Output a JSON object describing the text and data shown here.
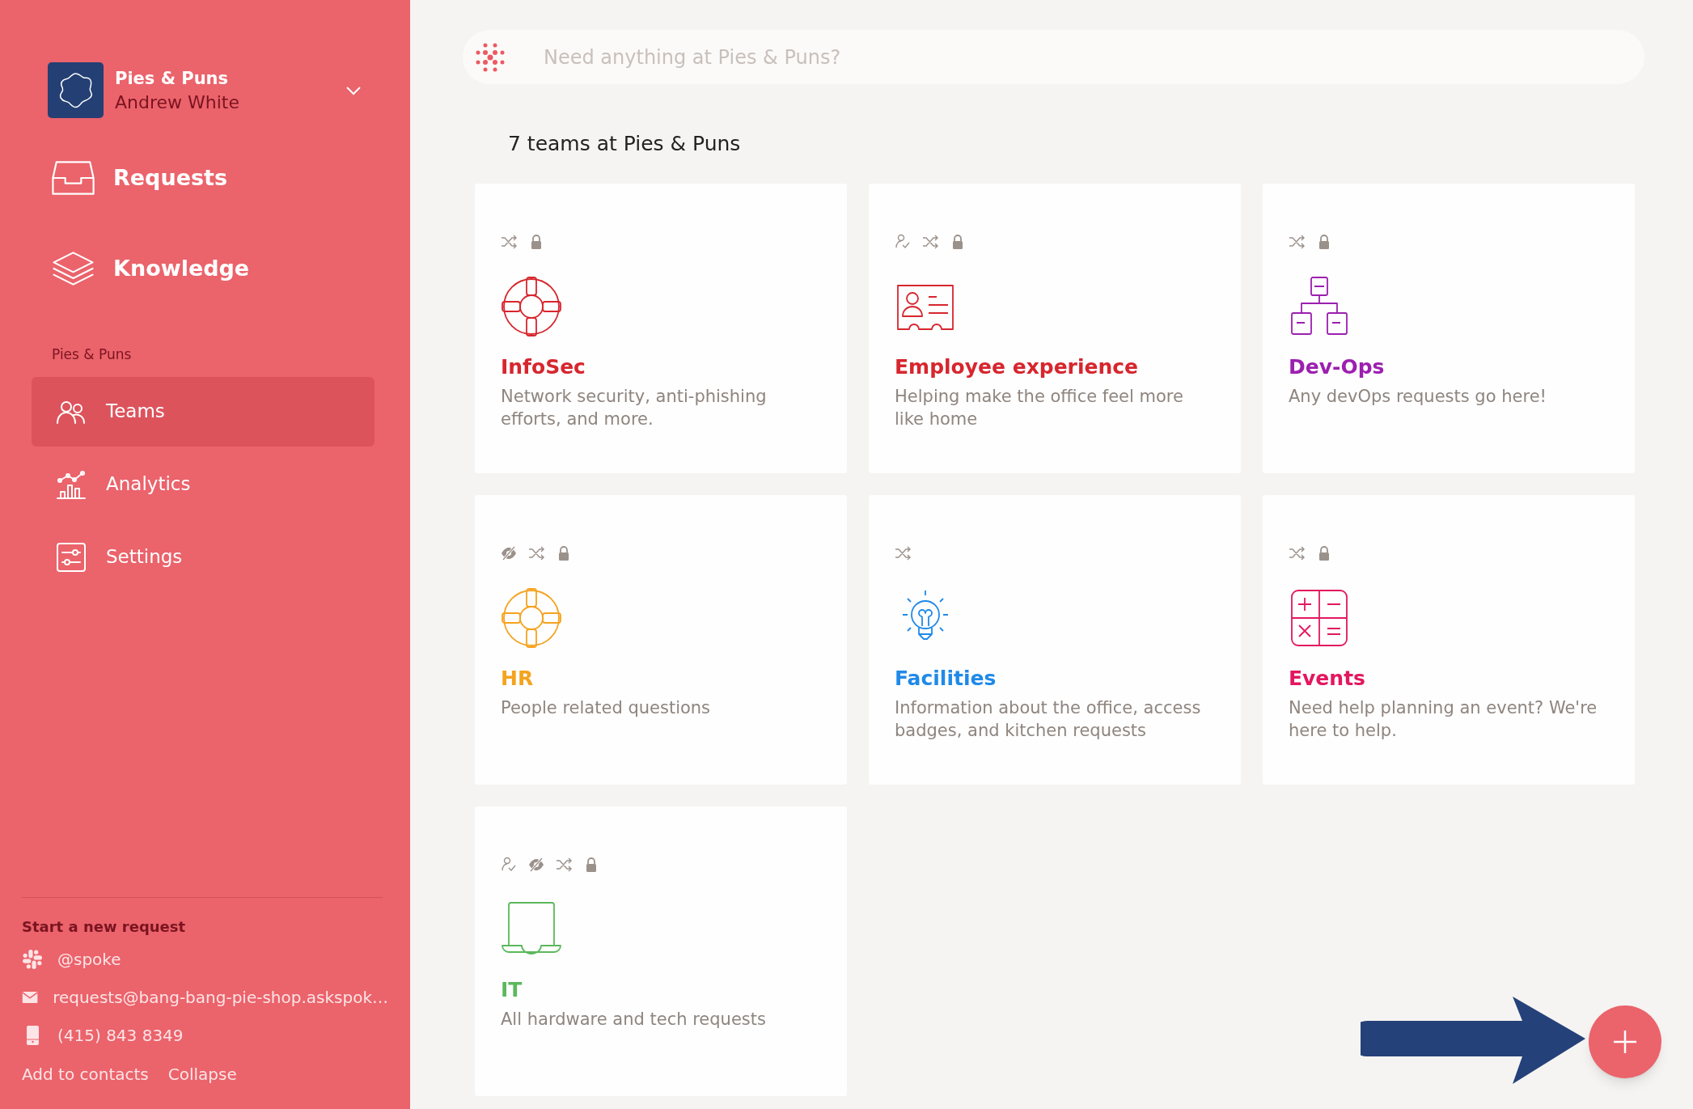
{
  "workspace": {
    "name": "Pies & Puns",
    "user": "Andrew White"
  },
  "nav": [
    {
      "label": "Requests"
    },
    {
      "label": "Knowledge"
    }
  ],
  "section_label": "Pies & Puns",
  "section_items": [
    {
      "label": "Teams",
      "selected": true
    },
    {
      "label": "Analytics",
      "selected": false
    },
    {
      "label": "Settings",
      "selected": false
    }
  ],
  "contact": {
    "heading": "Start a new request",
    "channels": [
      {
        "kind": "chat",
        "text": "@spoke"
      },
      {
        "kind": "email",
        "text": "requests@bang-bang-pie-shop.askspok…"
      },
      {
        "kind": "phone",
        "text": "(415) 843 8349"
      }
    ],
    "links": [
      "Add to contacts",
      "Collapse"
    ]
  },
  "search": {
    "placeholder": "Need anything at Pies & Puns?"
  },
  "heading": "7 teams at Pies & Puns",
  "teams": [
    {
      "name": "InfoSec",
      "description": "Network security, anti-phishing efforts, and more.",
      "color": "#d7262e",
      "badges": [
        {
          "kind": "shuffle"
        },
        {
          "kind": "lock"
        }
      ]
    },
    {
      "name": "Employee experience",
      "description": "Helping make the office feel more like home",
      "color": "#d7262e",
      "badges": [
        {
          "kind": "person"
        },
        {
          "kind": "shuffle"
        },
        {
          "kind": "lock"
        }
      ]
    },
    {
      "name": "Dev-Ops",
      "description": "Any devOps requests go here!",
      "color": "#9c1fb0",
      "badges": [
        {
          "kind": "shuffle"
        },
        {
          "kind": "lock"
        }
      ]
    },
    {
      "name": "HR",
      "description": "People related questions",
      "color": "#f5a31f",
      "badges": [
        {
          "kind": "eye"
        },
        {
          "kind": "shuffle"
        },
        {
          "kind": "lock"
        }
      ]
    },
    {
      "name": "Facilities",
      "description": "Information about the office, access badges, and kitchen requests",
      "color": "#1f8ae8",
      "badges": [
        {
          "kind": "shuffle"
        }
      ]
    },
    {
      "name": "Events",
      "description": "Need help planning an event? We're here to help.",
      "color": "#e3175f",
      "badges": [
        {
          "kind": "shuffle"
        },
        {
          "kind": "lock"
        }
      ]
    },
    {
      "name": "IT",
      "description": "All hardware and tech requests",
      "color": "#5cb85c",
      "badges": [
        {
          "kind": "person"
        },
        {
          "kind": "eye"
        },
        {
          "kind": "shuffle"
        },
        {
          "kind": "lock"
        }
      ]
    }
  ]
}
